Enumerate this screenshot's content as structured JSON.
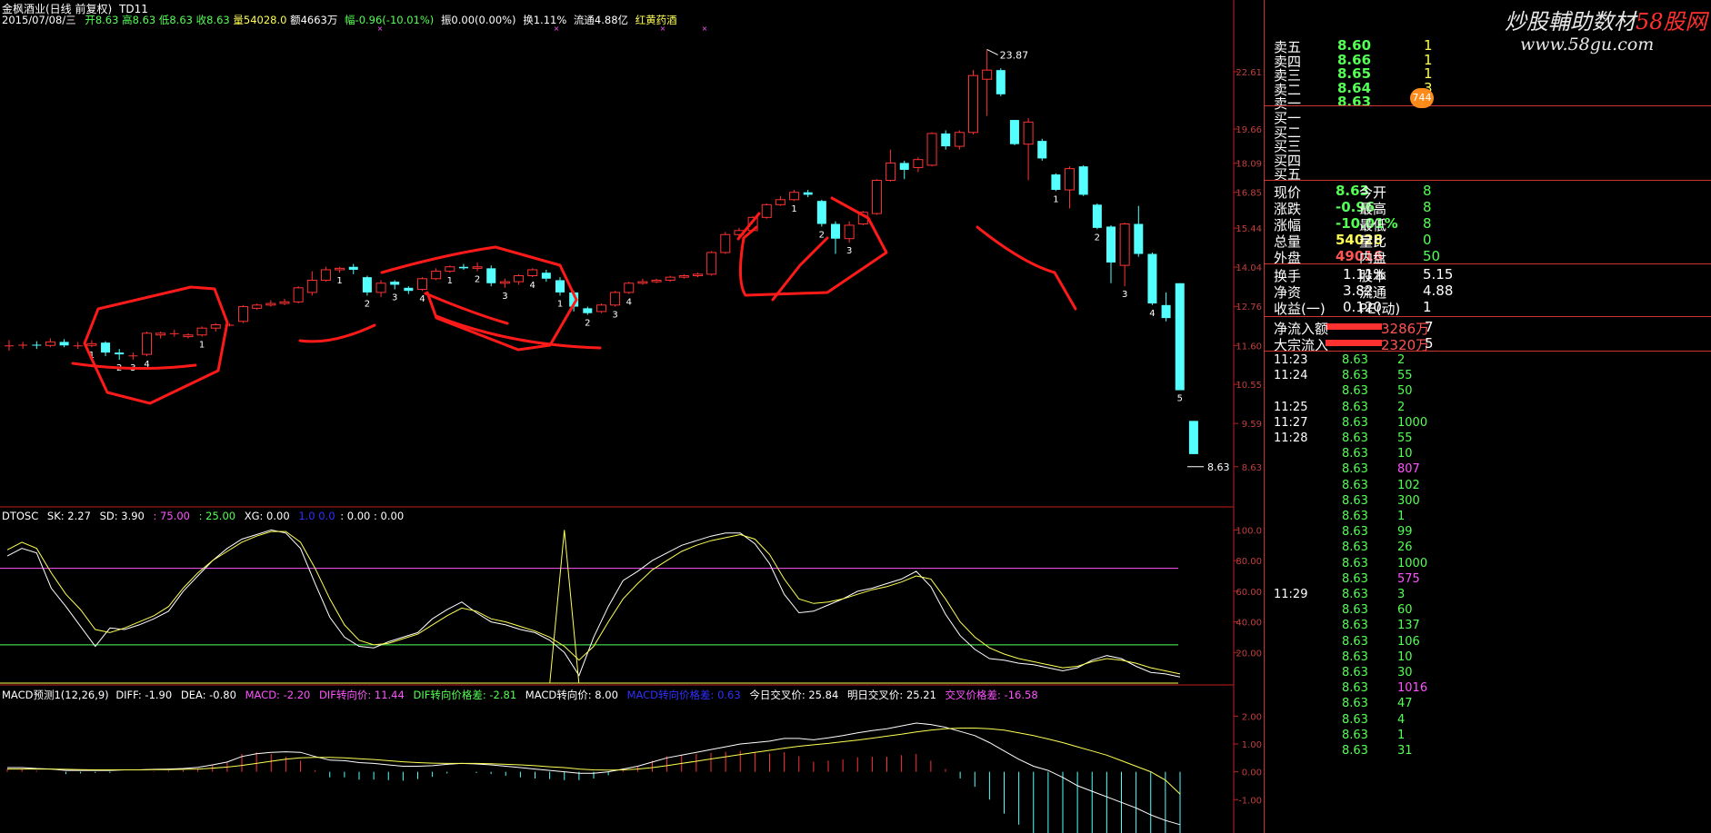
{
  "header": {
    "stock_title": "金枫酒业(日线 前复权)",
    "indicator": "TD11",
    "date": "2015/07/08/三",
    "open": "开8.63",
    "high": "高8.63",
    "low": "低8.63",
    "close": "收8.63",
    "volume": "量54028.0",
    "amount": "额4663万",
    "change": "幅-0.96(-10.01%)",
    "amplitude": "振0.00(0.00%)",
    "turnover": "换1.11%",
    "float_cap": "流通4.88亿",
    "sector": "红黄药酒"
  },
  "price_axis": [
    "22.61",
    "19.66",
    "18.09",
    "16.85",
    "15.44",
    "14.04",
    "12.76",
    "11.60",
    "10.55",
    "9.59",
    "8.63"
  ],
  "price_labels": {
    "high_mark": "23.87",
    "last_mark": "8.63"
  },
  "td_counts": [
    {
      "t": "1"
    },
    {
      "t": "2"
    },
    {
      "t": "3"
    },
    {
      "t": "4"
    },
    {
      "t": "1"
    },
    {
      "t": "1"
    },
    {
      "t": "2"
    },
    {
      "t": "3"
    },
    {
      "t": "4"
    },
    {
      "t": "1"
    },
    {
      "t": "2"
    },
    {
      "t": "3"
    },
    {
      "t": "4"
    },
    {
      "t": "1"
    },
    {
      "t": "2"
    },
    {
      "t": "3"
    },
    {
      "t": "4"
    },
    {
      "t": "1"
    },
    {
      "t": "2"
    },
    {
      "t": "3"
    },
    {
      "t": "1"
    },
    {
      "t": "2"
    },
    {
      "t": "3"
    },
    {
      "t": "4"
    },
    {
      "t": "5"
    },
    {
      "t": "6"
    },
    {
      "t": "7"
    },
    {
      "t": "8"
    }
  ],
  "dtosc": {
    "name": "DTOSC",
    "sk": "SK: 2.27",
    "sd": "SD: 3.90",
    "l75": ": 75.00",
    "l25": ": 25.00",
    "xg": "XG: 0.00",
    "blue": "1.0   0.0",
    "tail": ": 0.00 : 0.00",
    "axis": [
      "100.0",
      "80.00",
      "60.00",
      "40.00",
      "20.00"
    ]
  },
  "macd": {
    "name": "MACD预测1(12,26,9)",
    "diff": "DIFF: -1.90",
    "dea": "DEA: -0.80",
    "macd": "MACD: -2.20",
    "dif_turn": "DIF转向价: 11.44",
    "dif_turn_diff": "DIF转向价格差: -2.81",
    "macd_turn": "MACD转向价: 8.00",
    "blue": "MACD转向价格差: 0.63",
    "today_cross": "今日交叉价: 25.84",
    "tomorrow_cross": "明日交叉价: 25.21",
    "cross_diff": "交叉价格差: -16.58",
    "axis": [
      "2.00",
      "1.00",
      "0.00",
      "-1.00"
    ]
  },
  "watermark": {
    "line1": "炒股輔助数材",
    "line1_red": "58股网",
    "line2": "www.58gu.com"
  },
  "orderbook": [
    {
      "label": "卖五",
      "price": "8.60",
      "vol": "1"
    },
    {
      "label": "卖四",
      "price": "8.66",
      "vol": "1"
    },
    {
      "label": "卖三",
      "price": "8.65",
      "vol": "1"
    },
    {
      "label": "卖二",
      "price": "8.64",
      "vol": "3"
    },
    {
      "label": "卖一",
      "price": "8.63",
      "vol": "5"
    },
    {
      "label": "买一",
      "price": "",
      "vol": ""
    },
    {
      "label": "买二",
      "price": "",
      "vol": ""
    },
    {
      "label": "买三",
      "price": "",
      "vol": ""
    },
    {
      "label": "买四",
      "price": "",
      "vol": ""
    },
    {
      "label": "买五",
      "price": "",
      "vol": ""
    }
  ],
  "badge": "744",
  "quote": [
    {
      "l1": "现价",
      "v1": "8.63",
      "l2": "今开",
      "v2": "8"
    },
    {
      "l1": "涨跌",
      "v1": "-0.96",
      "l2": "最高",
      "v2": "8"
    },
    {
      "l1": "涨幅",
      "v1": "-10.01%",
      "l2": "最低",
      "v2": "8"
    },
    {
      "l1": "总量",
      "v1": "54028",
      "l2": "量比",
      "v2": "0"
    },
    {
      "l1": "外盘",
      "v1": "49016",
      "l2": "内盘",
      "v2": "50"
    }
  ],
  "fundamentals": [
    {
      "l1": "换手",
      "v1": "1.11%",
      "l2": "股本",
      "v2": "5.15"
    },
    {
      "l1": "净资",
      "v1": "3.82",
      "l2": "流通",
      "v2": "4.88"
    },
    {
      "l1": "收益(一)",
      "v1": "0.120",
      "l2": "PE(动)",
      "v2": "1"
    }
  ],
  "flows": [
    {
      "label": "净流入额",
      "value": "3286万",
      "tail": "7"
    },
    {
      "label": "大宗流入",
      "value": "2320万",
      "tail": "5"
    }
  ],
  "ticks": [
    {
      "time": "11:23",
      "price": "8.63",
      "vol": "2"
    },
    {
      "time": "11:24",
      "price": "8.63",
      "vol": "55"
    },
    {
      "time": "",
      "price": "8.63",
      "vol": "50"
    },
    {
      "time": "11:25",
      "price": "8.63",
      "vol": "2"
    },
    {
      "time": "11:27",
      "price": "8.63",
      "vol": "1000"
    },
    {
      "time": "11:28",
      "price": "8.63",
      "vol": "55"
    },
    {
      "time": "",
      "price": "8.63",
      "vol": "10"
    },
    {
      "time": "",
      "price": "8.63",
      "vol": "807"
    },
    {
      "time": "",
      "price": "8.63",
      "vol": "102"
    },
    {
      "time": "",
      "price": "8.63",
      "vol": "300"
    },
    {
      "time": "",
      "price": "8.63",
      "vol": "1"
    },
    {
      "time": "",
      "price": "8.63",
      "vol": "99"
    },
    {
      "time": "",
      "price": "8.63",
      "vol": "26"
    },
    {
      "time": "",
      "price": "8.63",
      "vol": "1000"
    },
    {
      "time": "",
      "price": "8.63",
      "vol": "575"
    },
    {
      "time": "11:29",
      "price": "8.63",
      "vol": "3"
    },
    {
      "time": "",
      "price": "8.63",
      "vol": "60"
    },
    {
      "time": "",
      "price": "8.63",
      "vol": "137"
    },
    {
      "time": "",
      "price": "8.63",
      "vol": "106"
    },
    {
      "time": "",
      "price": "8.63",
      "vol": "10"
    },
    {
      "time": "",
      "price": "8.63",
      "vol": "30"
    },
    {
      "time": "",
      "price": "8.63",
      "vol": "1016"
    },
    {
      "time": "",
      "price": "8.63",
      "vol": "47"
    },
    {
      "time": "",
      "price": "8.63",
      "vol": "4"
    },
    {
      "time": "",
      "price": "8.63",
      "vol": "1"
    },
    {
      "time": "",
      "price": "8.63",
      "vol": "31"
    }
  ],
  "colors": {
    "up": "#ff3232",
    "down": "#54ffff",
    "yellow": "#ffff54",
    "white": "#ffffff",
    "green": "#00ff00",
    "magenta": "#ff00ff",
    "blue": "#3030ff",
    "axis_red": "#c02020"
  },
  "candles": [
    {
      "o": 11.6,
      "c": 11.6,
      "h": 11.75,
      "l": 11.45
    },
    {
      "o": 11.6,
      "c": 11.62,
      "h": 11.7,
      "l": 11.5
    },
    {
      "o": 11.62,
      "c": 11.6,
      "h": 11.72,
      "l": 11.5
    },
    {
      "o": 11.6,
      "c": 11.7,
      "h": 11.8,
      "l": 11.55
    },
    {
      "o": 11.7,
      "c": 11.6,
      "h": 11.78,
      "l": 11.55
    },
    {
      "o": 11.6,
      "c": 11.6,
      "h": 11.7,
      "l": 11.5
    },
    {
      "o": 11.6,
      "c": 11.65,
      "h": 11.75,
      "l": 11.55
    },
    {
      "o": 11.68,
      "c": 11.4,
      "h": 11.72,
      "l": 11.3
    },
    {
      "o": 11.4,
      "c": 11.35,
      "h": 11.5,
      "l": 11.2
    },
    {
      "o": 11.3,
      "c": 11.32,
      "h": 11.4,
      "l": 11.2
    },
    {
      "o": 11.35,
      "c": 11.95,
      "h": 12.0,
      "l": 11.3
    },
    {
      "o": 11.9,
      "c": 11.95,
      "h": 12.0,
      "l": 11.8
    },
    {
      "o": 11.95,
      "c": 11.95,
      "h": 12.05,
      "l": 11.85
    },
    {
      "o": 11.85,
      "c": 11.9,
      "h": 11.95,
      "l": 11.8
    },
    {
      "o": 11.9,
      "c": 12.1,
      "h": 12.15,
      "l": 11.85
    },
    {
      "o": 12.1,
      "c": 12.2,
      "h": 12.25,
      "l": 12.0
    },
    {
      "o": 12.2,
      "c": 12.2,
      "h": 12.25,
      "l": 12.15
    },
    {
      "o": 12.3,
      "c": 12.75,
      "h": 12.8,
      "l": 12.25
    },
    {
      "o": 12.7,
      "c": 12.8,
      "h": 12.85,
      "l": 12.65
    },
    {
      "o": 12.8,
      "c": 12.85,
      "h": 12.95,
      "l": 12.75
    },
    {
      "o": 12.85,
      "c": 12.9,
      "h": 13.0,
      "l": 12.8
    },
    {
      "o": 12.9,
      "c": 13.35,
      "h": 13.4,
      "l": 12.85
    },
    {
      "o": 13.2,
      "c": 13.6,
      "h": 13.9,
      "l": 13.1
    },
    {
      "o": 13.6,
      "c": 13.95,
      "h": 14.05,
      "l": 13.55
    },
    {
      "o": 13.95,
      "c": 14.0,
      "h": 14.05,
      "l": 13.85
    },
    {
      "o": 14.05,
      "c": 13.95,
      "h": 14.15,
      "l": 13.8
    },
    {
      "o": 13.7,
      "c": 13.2,
      "h": 13.75,
      "l": 13.1
    },
    {
      "o": 13.2,
      "c": 13.5,
      "h": 13.6,
      "l": 13.05
    },
    {
      "o": 13.55,
      "c": 13.45,
      "h": 13.6,
      "l": 13.3
    },
    {
      "o": 13.35,
      "c": 13.25,
      "h": 13.4,
      "l": 13.15
    },
    {
      "o": 13.3,
      "c": 13.65,
      "h": 13.7,
      "l": 13.25
    },
    {
      "o": 13.65,
      "c": 13.9,
      "h": 14.0,
      "l": 13.6
    },
    {
      "o": 13.9,
      "c": 14.05,
      "h": 14.1,
      "l": 13.85
    },
    {
      "o": 14.05,
      "c": 14.0,
      "h": 14.15,
      "l": 13.95
    },
    {
      "o": 14.0,
      "c": 14.05,
      "h": 14.2,
      "l": 13.9
    },
    {
      "o": 14.0,
      "c": 13.5,
      "h": 14.1,
      "l": 13.4
    },
    {
      "o": 13.5,
      "c": 13.55,
      "h": 13.65,
      "l": 13.35
    },
    {
      "o": 13.55,
      "c": 13.75,
      "h": 13.8,
      "l": 13.45
    },
    {
      "o": 13.75,
      "c": 13.95,
      "h": 14.0,
      "l": 13.7
    },
    {
      "o": 13.85,
      "c": 13.65,
      "h": 13.95,
      "l": 13.55
    },
    {
      "o": 13.6,
      "c": 13.2,
      "h": 13.7,
      "l": 13.1
    },
    {
      "o": 13.2,
      "c": 12.75,
      "h": 13.25,
      "l": 12.6
    },
    {
      "o": 12.7,
      "c": 12.55,
      "h": 12.75,
      "l": 12.5
    },
    {
      "o": 12.6,
      "c": 12.8,
      "h": 12.85,
      "l": 12.55
    },
    {
      "o": 12.8,
      "c": 13.2,
      "h": 13.25,
      "l": 12.75
    },
    {
      "o": 13.2,
      "c": 13.5,
      "h": 13.55,
      "l": 13.15
    },
    {
      "o": 13.5,
      "c": 13.55,
      "h": 13.65,
      "l": 13.45
    },
    {
      "o": 13.55,
      "c": 13.6,
      "h": 13.65,
      "l": 13.5
    },
    {
      "o": 13.6,
      "c": 13.7,
      "h": 13.75,
      "l": 13.55
    },
    {
      "o": 13.7,
      "c": 13.75,
      "h": 13.8,
      "l": 13.65
    },
    {
      "o": 13.75,
      "c": 13.8,
      "h": 13.85,
      "l": 13.7
    },
    {
      "o": 13.8,
      "c": 14.55,
      "h": 14.6,
      "l": 13.75
    },
    {
      "o": 14.55,
      "c": 15.2,
      "h": 15.3,
      "l": 14.5
    },
    {
      "o": 15.2,
      "c": 15.35,
      "h": 15.45,
      "l": 15.1
    },
    {
      "o": 15.35,
      "c": 15.85,
      "h": 15.9,
      "l": 15.3
    },
    {
      "o": 15.85,
      "c": 16.35,
      "h": 16.4,
      "l": 15.8
    },
    {
      "o": 16.35,
      "c": 16.55,
      "h": 16.7,
      "l": 16.3
    },
    {
      "o": 16.55,
      "c": 16.85,
      "h": 16.95,
      "l": 16.5
    },
    {
      "o": 16.85,
      "c": 16.75,
      "h": 16.95,
      "l": 16.65
    },
    {
      "o": 16.5,
      "c": 15.6,
      "h": 16.55,
      "l": 15.5
    },
    {
      "o": 15.6,
      "c": 15.05,
      "h": 15.7,
      "l": 14.5
    },
    {
      "o": 15.05,
      "c": 15.55,
      "h": 15.7,
      "l": 14.9
    },
    {
      "o": 15.6,
      "c": 16.05,
      "h": 16.1,
      "l": 15.55
    },
    {
      "o": 16.0,
      "c": 17.35,
      "h": 17.4,
      "l": 15.95
    },
    {
      "o": 17.35,
      "c": 18.1,
      "h": 18.7,
      "l": 17.3
    },
    {
      "o": 18.1,
      "c": 17.8,
      "h": 18.2,
      "l": 17.4
    },
    {
      "o": 17.9,
      "c": 18.25,
      "h": 18.35,
      "l": 17.7
    },
    {
      "o": 18.0,
      "c": 19.45,
      "h": 19.5,
      "l": 17.95
    },
    {
      "o": 19.45,
      "c": 18.85,
      "h": 19.6,
      "l": 18.7
    },
    {
      "o": 18.85,
      "c": 19.5,
      "h": 19.6,
      "l": 18.7
    },
    {
      "o": 19.5,
      "c": 22.4,
      "h": 22.7,
      "l": 19.4
    },
    {
      "o": 22.2,
      "c": 22.7,
      "h": 23.87,
      "l": 20.3
    },
    {
      "o": 22.7,
      "c": 21.4,
      "h": 22.8,
      "l": 21.3
    },
    {
      "o": 20.1,
      "c": 18.95,
      "h": 20.1,
      "l": 18.9
    },
    {
      "o": 18.95,
      "c": 20.0,
      "h": 20.2,
      "l": 17.35
    },
    {
      "o": 19.1,
      "c": 18.3,
      "h": 19.2,
      "l": 18.2
    },
    {
      "o": 17.6,
      "c": 16.95,
      "h": 17.65,
      "l": 16.9
    },
    {
      "o": 16.95,
      "c": 17.85,
      "h": 17.95,
      "l": 16.2
    },
    {
      "o": 17.95,
      "c": 16.75,
      "h": 18.0,
      "l": 16.7
    },
    {
      "o": 16.35,
      "c": 15.45,
      "h": 16.4,
      "l": 15.4
    },
    {
      "o": 15.5,
      "c": 14.2,
      "h": 15.55,
      "l": 13.5
    },
    {
      "o": 14.1,
      "c": 15.6,
      "h": 15.65,
      "l": 13.4
    },
    {
      "o": 15.6,
      "c": 14.5,
      "h": 16.3,
      "l": 14.4
    },
    {
      "o": 14.5,
      "c": 12.85,
      "h": 14.55,
      "l": 12.8
    },
    {
      "o": 12.8,
      "c": 12.4,
      "h": 13.2,
      "l": 12.3
    },
    {
      "o": 13.5,
      "c": 10.4,
      "h": 13.5,
      "l": 10.4
    },
    {
      "o": 9.65,
      "c": 8.9,
      "h": 9.65,
      "l": 8.9
    }
  ],
  "osc_sk": [
    83,
    88,
    85,
    62,
    50,
    37,
    24,
    36,
    35,
    38,
    42,
    47,
    60,
    70,
    80,
    88,
    94,
    97,
    100,
    98,
    88,
    65,
    43,
    30,
    24,
    23,
    27,
    30,
    33,
    42,
    48,
    53,
    46,
    40,
    38,
    35,
    33,
    28,
    20,
    5,
    30,
    50,
    67,
    73,
    80,
    85,
    90,
    93,
    96,
    98,
    98,
    91,
    78,
    58,
    46,
    47,
    51,
    55,
    60,
    62,
    65,
    68,
    73,
    63,
    45,
    31,
    22,
    16,
    15,
    13,
    12,
    10,
    8,
    10,
    15,
    18,
    16,
    11,
    7,
    6,
    4
  ],
  "osc_sd": [
    87,
    92,
    88,
    72,
    58,
    48,
    35,
    33,
    36,
    40,
    44,
    50,
    62,
    72,
    80,
    86,
    92,
    96,
    99,
    99,
    92,
    75,
    55,
    38,
    28,
    25,
    26,
    29,
    32,
    38,
    44,
    49,
    47,
    42,
    40,
    37,
    34,
    30,
    24,
    15,
    24,
    40,
    55,
    65,
    74,
    80,
    86,
    90,
    93,
    95,
    97,
    94,
    84,
    68,
    55,
    52,
    53,
    55,
    58,
    61,
    63,
    66,
    70,
    68,
    55,
    40,
    30,
    23,
    19,
    16,
    14,
    12,
    10,
    11,
    14,
    16,
    15,
    13,
    10,
    8,
    6
  ],
  "osc_spike_value": 100,
  "macd_diff": [
    0.15,
    0.15,
    0.12,
    0.1,
    0.05,
    0.05,
    0.05,
    0.05,
    0.07,
    0.07,
    0.09,
    0.1,
    0.12,
    0.16,
    0.25,
    0.35,
    0.55,
    0.65,
    0.7,
    0.72,
    0.7,
    0.55,
    0.42,
    0.4,
    0.33,
    0.3,
    0.25,
    0.2,
    0.2,
    0.22,
    0.27,
    0.3,
    0.28,
    0.25,
    0.2,
    0.15,
    0.1,
    0.05,
    0.0,
    -0.05,
    -0.05,
    0.0,
    0.1,
    0.2,
    0.35,
    0.5,
    0.6,
    0.7,
    0.8,
    0.9,
    1.0,
    1.05,
    1.1,
    1.2,
    1.2,
    1.15,
    1.22,
    1.3,
    1.4,
    1.48,
    1.55,
    1.65,
    1.75,
    1.7,
    1.6,
    1.45,
    1.3,
    1.05,
    0.75,
    0.45,
    0.2,
    0.05,
    -0.2,
    -0.5,
    -0.7,
    -0.9,
    -1.1,
    -1.3,
    -1.55,
    -1.75,
    -1.9
  ],
  "macd_dea": [
    0.1,
    0.1,
    0.1,
    0.1,
    0.09,
    0.08,
    0.07,
    0.07,
    0.07,
    0.07,
    0.08,
    0.08,
    0.09,
    0.1,
    0.13,
    0.17,
    0.23,
    0.3,
    0.38,
    0.45,
    0.5,
    0.52,
    0.52,
    0.5,
    0.47,
    0.44,
    0.4,
    0.36,
    0.33,
    0.31,
    0.3,
    0.3,
    0.3,
    0.29,
    0.27,
    0.25,
    0.22,
    0.18,
    0.15,
    0.1,
    0.07,
    0.06,
    0.07,
    0.1,
    0.15,
    0.22,
    0.3,
    0.38,
    0.46,
    0.54,
    0.62,
    0.7,
    0.77,
    0.85,
    0.92,
    0.97,
    1.02,
    1.08,
    1.14,
    1.21,
    1.28,
    1.35,
    1.43,
    1.5,
    1.55,
    1.57,
    1.57,
    1.55,
    1.5,
    1.4,
    1.3,
    1.18,
    1.05,
    0.9,
    0.75,
    0.6,
    0.4,
    0.2,
    0.0,
    -0.3,
    -0.8
  ]
}
